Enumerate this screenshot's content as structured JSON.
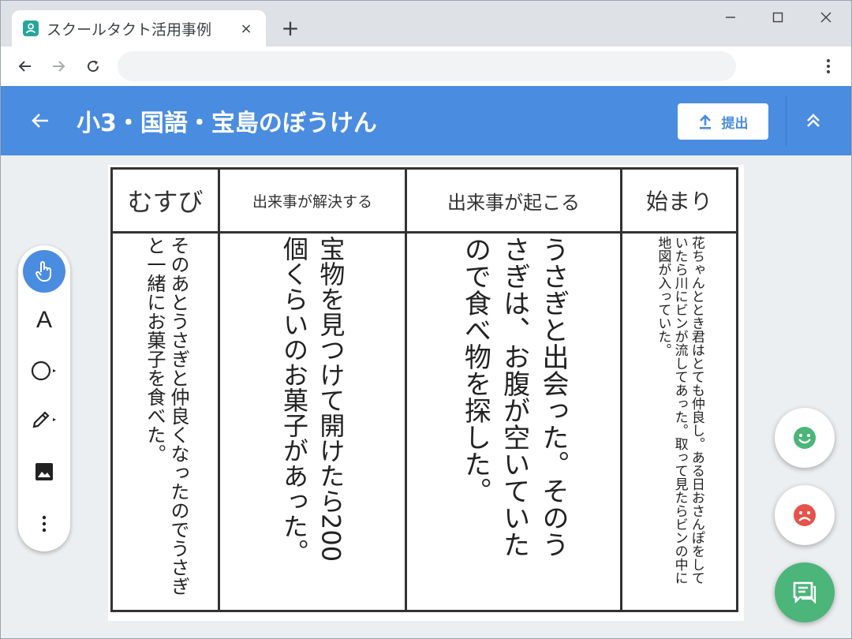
{
  "browser": {
    "tab_title": "スクールタクト活用事例",
    "tab_close": "×",
    "new_tab": "+"
  },
  "app": {
    "title": "小3・国語・宝島のぼうけん",
    "submit_label": "提出"
  },
  "worksheet": {
    "columns": [
      {
        "header": "むすび",
        "body": "そのあとうさぎと仲良くなったのでうさぎと一緒にお菓子を食べた。"
      },
      {
        "header": "出来事が解決する",
        "body": "宝物を見つけて開けたら200個くらいのお菓子があった。"
      },
      {
        "header": "出来事が起こる",
        "body": "うさぎと出会った。そのうさぎは、お腹が空いていたので食べ物を探した。"
      },
      {
        "header": "始まり",
        "body": "花ちゃんととき君はとても仲良し。ある日おさんぽをしていたら川にビンが流してあった。取って見たらビンの中に地図が入っていた。"
      }
    ]
  },
  "tools": {
    "text_tool": "A"
  },
  "colors": {
    "accent": "#4a8cdf",
    "good": "#4cb57a",
    "bad": "#e5534b"
  }
}
